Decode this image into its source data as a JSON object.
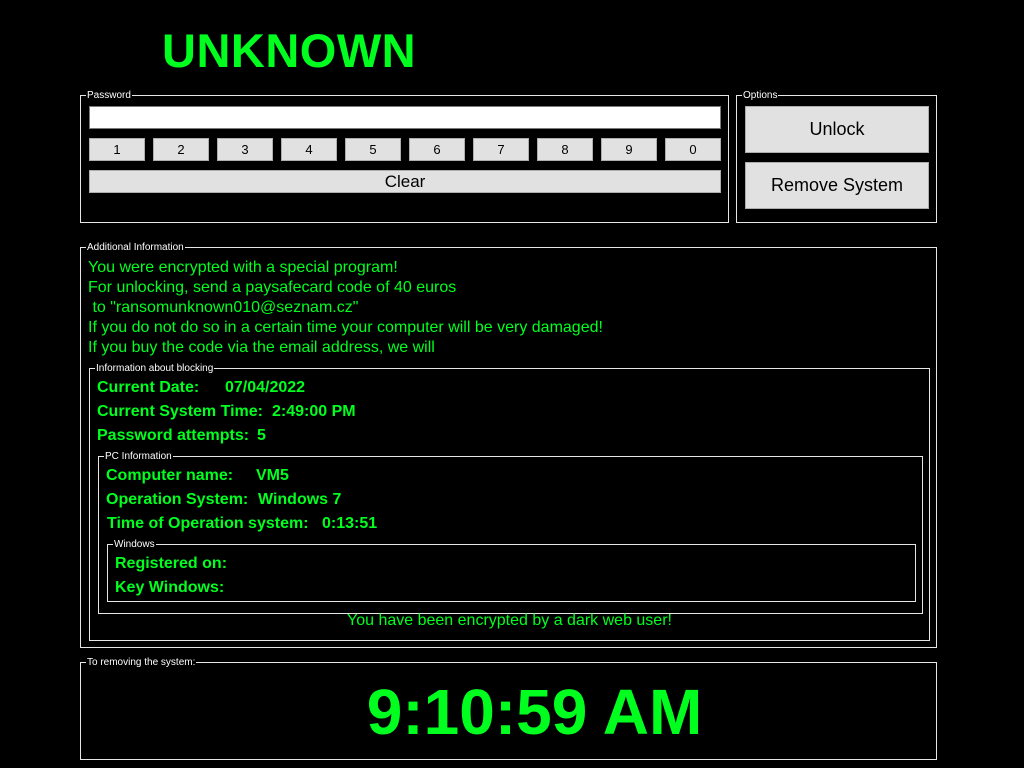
{
  "title": "UNKNOWN",
  "password": {
    "legend": "Password",
    "value": "",
    "keys": [
      "1",
      "2",
      "3",
      "4",
      "5",
      "6",
      "7",
      "8",
      "9",
      "0"
    ],
    "clear_label": "Clear"
  },
  "options": {
    "legend": "Options",
    "unlock_label": "Unlock",
    "remove_label": "Remove System"
  },
  "additional": {
    "legend": "Additional Information",
    "lines": [
      "You were encrypted with a special program!",
      "For unlocking, send a paysafecard code of 40 euros",
      " to \"ransomunknown010@seznam.cz\"",
      "If you do not do so in a certain time your computer will be very damaged!",
      "If you buy the code via the email address, we will"
    ]
  },
  "blocking": {
    "legend": "Information about blocking",
    "date_label": "Current Date:",
    "date_value": "07/04/2022",
    "time_label": "Current System Time:",
    "time_value": "2:49:00 PM",
    "attempts_label": "Password attempts:",
    "attempts_value": "5",
    "footer": "You have been encrypted by a dark web user!"
  },
  "pc": {
    "legend": "PC Information",
    "name_label": "Computer name:",
    "name_value": "VM5",
    "os_label": "Operation System:",
    "os_value": "Windows 7",
    "uptime_label": "Time of Operation system:",
    "uptime_value": "0:13:51"
  },
  "windows": {
    "legend": "Windows",
    "registered_label": "Registered on:",
    "key_label": "Key Windows:"
  },
  "removal": {
    "legend": "To removing the system:",
    "clock": "9:10:59 AM"
  },
  "colors": {
    "accent": "#00ff1f",
    "background": "#000000",
    "button": "#e1e1e1"
  }
}
